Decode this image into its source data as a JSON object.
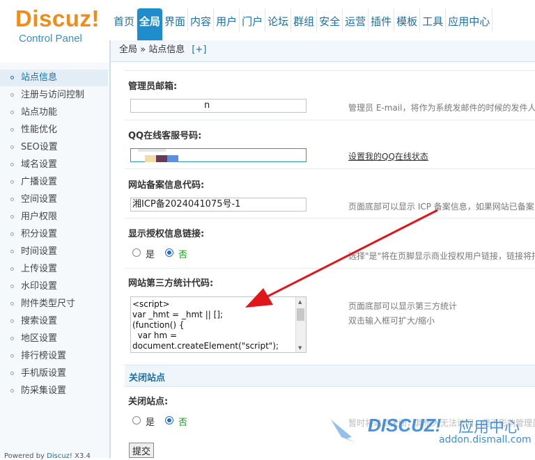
{
  "logo": {
    "brand": "Discuz!",
    "subtitle": "Control Panel"
  },
  "nav": {
    "tabs": [
      {
        "label": "首页"
      },
      {
        "label": "全局"
      },
      {
        "label": "界面"
      },
      {
        "label": "内容"
      },
      {
        "label": "用户"
      },
      {
        "label": "门户"
      },
      {
        "label": "论坛"
      },
      {
        "label": "群组"
      },
      {
        "label": "安全"
      },
      {
        "label": "运营"
      },
      {
        "label": "插件"
      },
      {
        "label": "模板"
      },
      {
        "label": "工具"
      },
      {
        "label": "应用中心"
      }
    ],
    "active": "全局"
  },
  "breadcrumb": {
    "text": "全局 » 站点信息",
    "add": "[+]"
  },
  "sidebar": {
    "items": [
      {
        "label": "站点信息"
      },
      {
        "label": "注册与访问控制"
      },
      {
        "label": "站点功能"
      },
      {
        "label": "性能优化"
      },
      {
        "label": "SEO设置"
      },
      {
        "label": "域名设置"
      },
      {
        "label": "广播设置"
      },
      {
        "label": "空间设置"
      },
      {
        "label": "用户权限"
      },
      {
        "label": "积分设置"
      },
      {
        "label": "时间设置"
      },
      {
        "label": "上传设置"
      },
      {
        "label": "水印设置"
      },
      {
        "label": "附件类型尺寸"
      },
      {
        "label": "搜索设置"
      },
      {
        "label": "地区设置"
      },
      {
        "label": "排行榜设置"
      },
      {
        "label": "手机版设置"
      },
      {
        "label": "防采集设置"
      }
    ],
    "active": "站点信息"
  },
  "powered": {
    "prefix": "Powered by ",
    "brand": "Discuz!",
    "version": " X3.4"
  },
  "form": {
    "admin_email": {
      "label": "管理员邮箱:",
      "value": "n",
      "tip": "管理员 E-mail，将作为系统发邮件的时候的发件人"
    },
    "qq": {
      "label": "QQ在线客服号码:",
      "tip": "设置我的QQ在线状态"
    },
    "icp": {
      "label": "网站备案信息代码:",
      "value": "湘ICP备2024041075号-1",
      "tip": "页面底部可以显示 ICP 备案信息，如果网站已备案"
    },
    "license_link": {
      "label": "显示授权信息链接:",
      "yes": "是",
      "no": "否",
      "selected": "no",
      "tip": "选择\"是\"将在页脚显示商业授权用户链接，链接将指"
    },
    "stats_code": {
      "label": "网站第三方统计代码:",
      "value": "<script>\nvar _hmt = _hmt || [];\n(function() {\n  var hm =\ndocument.createElement(\"script\");",
      "tip": "页面底部可以显示第三方统计",
      "tip2": "双击输入框可扩大/缩小"
    },
    "close_section": {
      "title": "关闭站点"
    },
    "close_site": {
      "label": "关闭站点:",
      "yes": "是",
      "no": "否",
      "selected": "no",
      "tip": "暂时将站点关闭，其他人无法访问，但不影响管理员"
    },
    "submit": "提交"
  },
  "watermark": {
    "brand": "DISCUZ!",
    "cn": "应用中心",
    "url": "addon.dismall.com"
  },
  "colors": {
    "accent": "#1e8dca",
    "link": "#1a6fa3",
    "logo": "#f08c1a",
    "annotation_arrow": "#e0161b",
    "radio": "#1e6fd0",
    "no_label": "#1a9e1a"
  }
}
